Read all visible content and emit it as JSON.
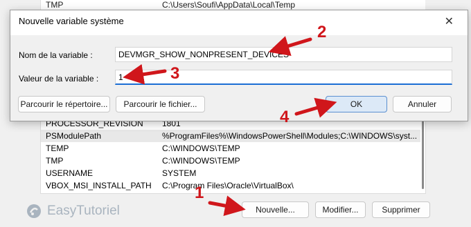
{
  "background": {
    "top_row": {
      "name": "TMP",
      "value": "C:\\Users\\Soufi\\AppData\\Local\\Temp"
    },
    "rows": [
      {
        "name": "PROCESSOR_REVISION",
        "value": "1801",
        "selected": false
      },
      {
        "name": "PSModulePath",
        "value": "%ProgramFiles%\\WindowsPowerShell\\Modules;C:\\WINDOWS\\syst...",
        "selected": true
      },
      {
        "name": "TEMP",
        "value": "C:\\WINDOWS\\TEMP",
        "selected": false
      },
      {
        "name": "TMP",
        "value": "C:\\WINDOWS\\TEMP",
        "selected": false
      },
      {
        "name": "USERNAME",
        "value": "SYSTEM",
        "selected": false
      },
      {
        "name": "VBOX_MSI_INSTALL_PATH",
        "value": "C:\\Program Files\\Oracle\\VirtualBox\\",
        "selected": false
      }
    ],
    "buttons": {
      "new": "Nouvelle...",
      "edit": "Modifier...",
      "delete": "Supprimer"
    }
  },
  "dialog": {
    "title": "Nouvelle variable système",
    "close_glyph": "✕",
    "name_label": "Nom de la variable :",
    "name_value": "DEVMGR_SHOW_NONPRESENT_DEVICES",
    "value_label": "Valeur de la variable :",
    "value_value": "1",
    "browse_dir": "Parcourir le répertoire...",
    "browse_file": "Parcourir le fichier...",
    "ok": "OK",
    "cancel": "Annuler"
  },
  "annotations": {
    "a1": "1",
    "a2": "2",
    "a3": "3",
    "a4": "4",
    "color": "#d0161b"
  },
  "watermark": {
    "text": "EasyTutoriel",
    "icon": "easytutoriel-logo-icon"
  }
}
